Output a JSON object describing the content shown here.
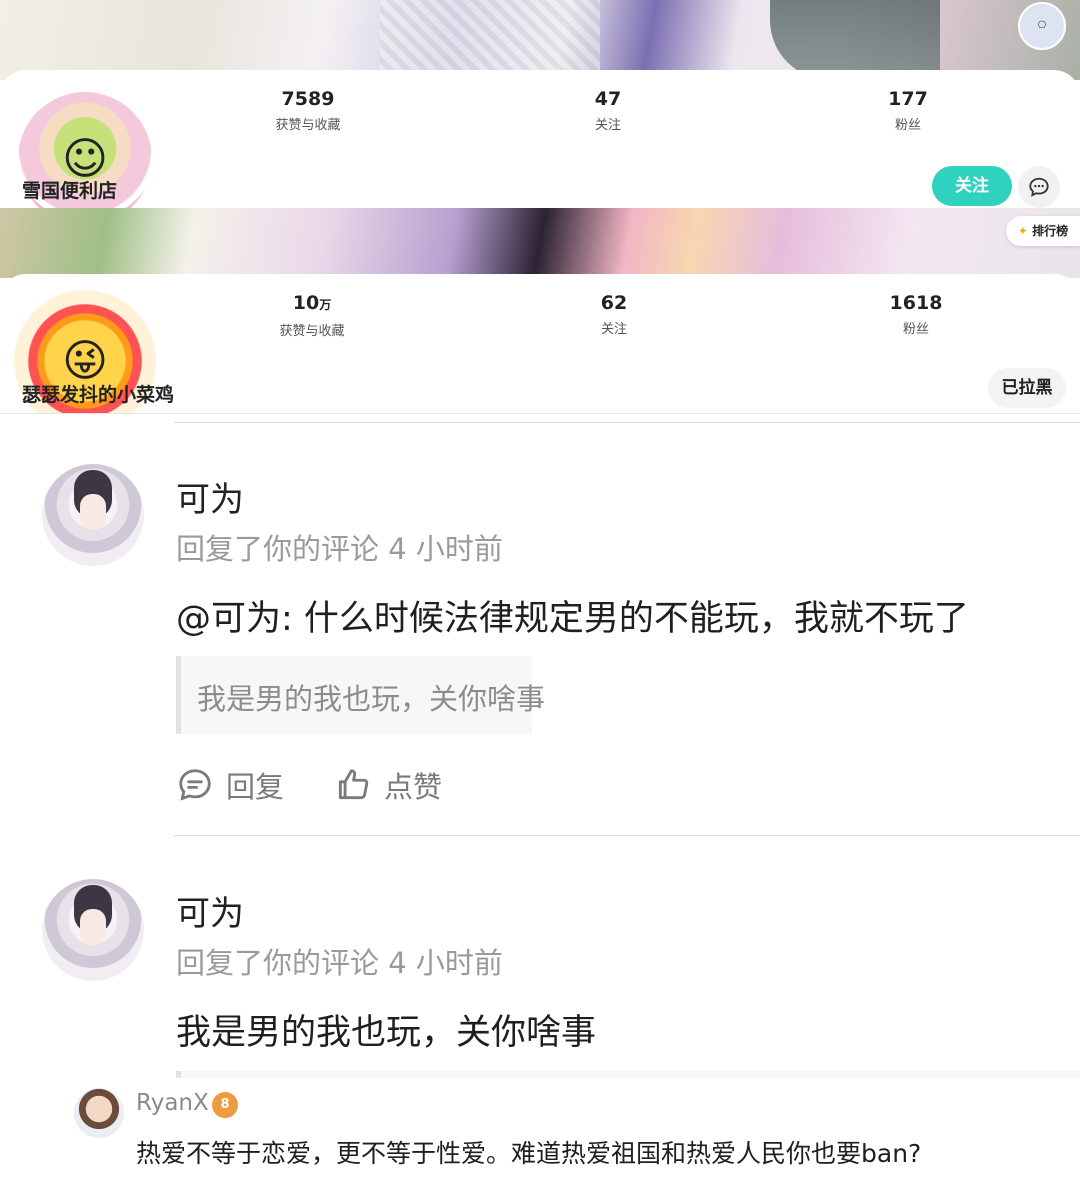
{
  "profiles": [
    {
      "name": "雪国便利店",
      "likes": "7589",
      "likes_label": "获赞与收藏",
      "following": "47",
      "following_label": "关注",
      "followers": "177",
      "followers_label": "粉丝",
      "follow_label": "关注"
    },
    {
      "name": "瑟瑟发抖的小菜鸡",
      "likes_num": "10",
      "likes_unit": "万",
      "likes_label": "获赞与收藏",
      "following": "62",
      "following_label": "关注",
      "followers": "1618",
      "followers_label": "粉丝",
      "blocked_label": "已拉黑",
      "rank_label": "排行榜"
    }
  ],
  "comments": [
    {
      "author": "可为",
      "meta": "回复了你的评论 4 小时前",
      "text": "@可为: 什么时候法律规定男的不能玩，我就不玩了",
      "quote": "我是男的我也玩，关你啥事",
      "reply_label": "回复",
      "like_label": "点赞"
    },
    {
      "author": "可为",
      "meta": "回复了你的评论 4 小时前",
      "text": "我是男的我也玩，关你啥事"
    }
  ],
  "reply": {
    "author": "RyanX",
    "badge": "8",
    "text": "热爱不等于恋爱，更不等于性爱。难道热爱祖国和热爱人民你也要ban?"
  },
  "colors": {
    "accent": "#2fd1bf",
    "muted_text": "#9a9a9a"
  }
}
